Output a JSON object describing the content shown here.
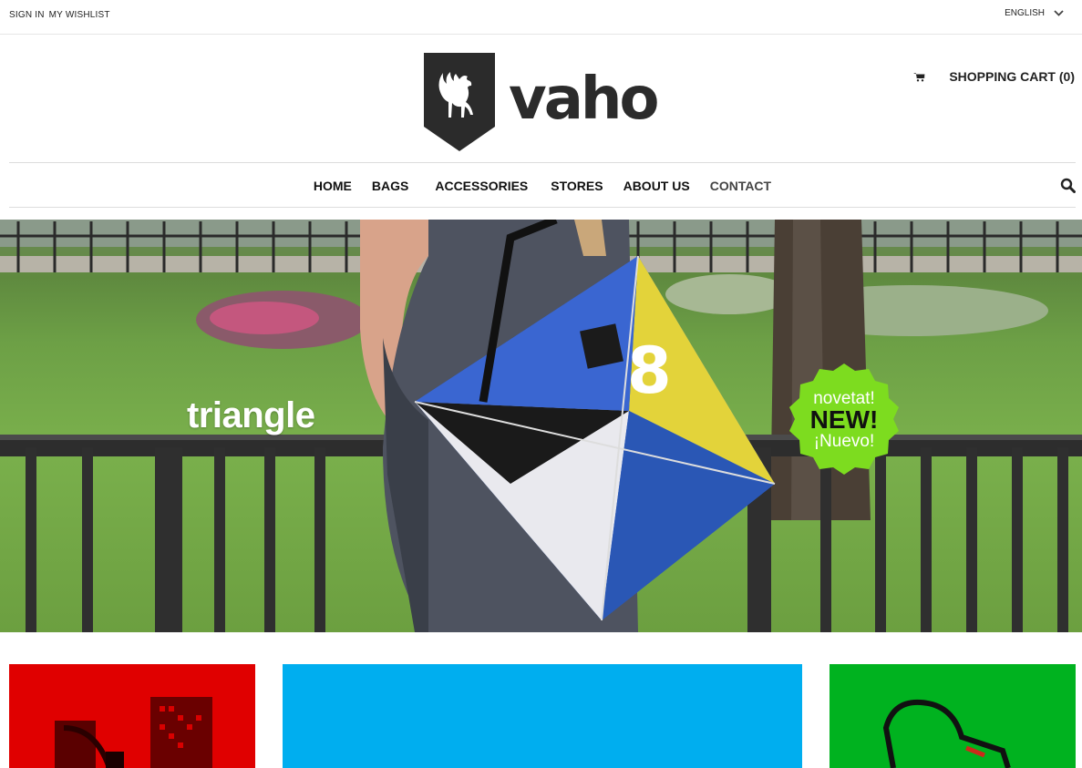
{
  "topbar": {
    "sign_in": "SIGN IN",
    "wishlist": "MY WISHLIST",
    "language": "ENGLISH"
  },
  "brand": {
    "name": "vaho"
  },
  "cart": {
    "label": "SHOPPING CART (0)",
    "icon": "cart-icon"
  },
  "nav": {
    "items": [
      "HOME",
      "BAGS",
      "ACCESSORIES",
      "STORES",
      "ABOUT US",
      "CONTACT"
    ],
    "search_icon": "search-icon"
  },
  "hero": {
    "caption": "triangle",
    "bag_number": "8",
    "badge": {
      "line1": "novetat!",
      "line2": "NEW!",
      "line3": "¡Nuevo!"
    }
  },
  "tiles": [
    {
      "color": "#e00000"
    },
    {
      "color": "#00aeef"
    },
    {
      "color": "#00b21f"
    }
  ],
  "colors": {
    "badge_green": "#7ddc1f",
    "text_dark": "#222222"
  }
}
